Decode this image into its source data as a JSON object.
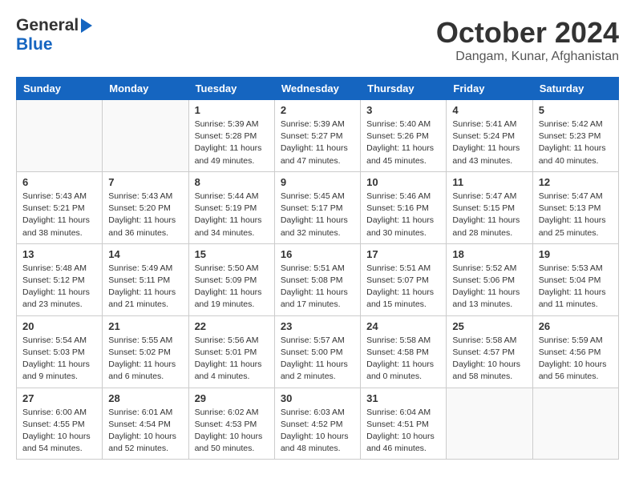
{
  "header": {
    "logo_general": "General",
    "logo_blue": "Blue",
    "month": "October 2024",
    "location": "Dangam, Kunar, Afghanistan"
  },
  "days_of_week": [
    "Sunday",
    "Monday",
    "Tuesday",
    "Wednesday",
    "Thursday",
    "Friday",
    "Saturday"
  ],
  "weeks": [
    [
      {
        "day": "",
        "info": ""
      },
      {
        "day": "",
        "info": ""
      },
      {
        "day": "1",
        "info": "Sunrise: 5:39 AM\nSunset: 5:28 PM\nDaylight: 11 hours and 49 minutes."
      },
      {
        "day": "2",
        "info": "Sunrise: 5:39 AM\nSunset: 5:27 PM\nDaylight: 11 hours and 47 minutes."
      },
      {
        "day": "3",
        "info": "Sunrise: 5:40 AM\nSunset: 5:26 PM\nDaylight: 11 hours and 45 minutes."
      },
      {
        "day": "4",
        "info": "Sunrise: 5:41 AM\nSunset: 5:24 PM\nDaylight: 11 hours and 43 minutes."
      },
      {
        "day": "5",
        "info": "Sunrise: 5:42 AM\nSunset: 5:23 PM\nDaylight: 11 hours and 40 minutes."
      }
    ],
    [
      {
        "day": "6",
        "info": "Sunrise: 5:43 AM\nSunset: 5:21 PM\nDaylight: 11 hours and 38 minutes."
      },
      {
        "day": "7",
        "info": "Sunrise: 5:43 AM\nSunset: 5:20 PM\nDaylight: 11 hours and 36 minutes."
      },
      {
        "day": "8",
        "info": "Sunrise: 5:44 AM\nSunset: 5:19 PM\nDaylight: 11 hours and 34 minutes."
      },
      {
        "day": "9",
        "info": "Sunrise: 5:45 AM\nSunset: 5:17 PM\nDaylight: 11 hours and 32 minutes."
      },
      {
        "day": "10",
        "info": "Sunrise: 5:46 AM\nSunset: 5:16 PM\nDaylight: 11 hours and 30 minutes."
      },
      {
        "day": "11",
        "info": "Sunrise: 5:47 AM\nSunset: 5:15 PM\nDaylight: 11 hours and 28 minutes."
      },
      {
        "day": "12",
        "info": "Sunrise: 5:47 AM\nSunset: 5:13 PM\nDaylight: 11 hours and 25 minutes."
      }
    ],
    [
      {
        "day": "13",
        "info": "Sunrise: 5:48 AM\nSunset: 5:12 PM\nDaylight: 11 hours and 23 minutes."
      },
      {
        "day": "14",
        "info": "Sunrise: 5:49 AM\nSunset: 5:11 PM\nDaylight: 11 hours and 21 minutes."
      },
      {
        "day": "15",
        "info": "Sunrise: 5:50 AM\nSunset: 5:09 PM\nDaylight: 11 hours and 19 minutes."
      },
      {
        "day": "16",
        "info": "Sunrise: 5:51 AM\nSunset: 5:08 PM\nDaylight: 11 hours and 17 minutes."
      },
      {
        "day": "17",
        "info": "Sunrise: 5:51 AM\nSunset: 5:07 PM\nDaylight: 11 hours and 15 minutes."
      },
      {
        "day": "18",
        "info": "Sunrise: 5:52 AM\nSunset: 5:06 PM\nDaylight: 11 hours and 13 minutes."
      },
      {
        "day": "19",
        "info": "Sunrise: 5:53 AM\nSunset: 5:04 PM\nDaylight: 11 hours and 11 minutes."
      }
    ],
    [
      {
        "day": "20",
        "info": "Sunrise: 5:54 AM\nSunset: 5:03 PM\nDaylight: 11 hours and 9 minutes."
      },
      {
        "day": "21",
        "info": "Sunrise: 5:55 AM\nSunset: 5:02 PM\nDaylight: 11 hours and 6 minutes."
      },
      {
        "day": "22",
        "info": "Sunrise: 5:56 AM\nSunset: 5:01 PM\nDaylight: 11 hours and 4 minutes."
      },
      {
        "day": "23",
        "info": "Sunrise: 5:57 AM\nSunset: 5:00 PM\nDaylight: 11 hours and 2 minutes."
      },
      {
        "day": "24",
        "info": "Sunrise: 5:58 AM\nSunset: 4:58 PM\nDaylight: 11 hours and 0 minutes."
      },
      {
        "day": "25",
        "info": "Sunrise: 5:58 AM\nSunset: 4:57 PM\nDaylight: 10 hours and 58 minutes."
      },
      {
        "day": "26",
        "info": "Sunrise: 5:59 AM\nSunset: 4:56 PM\nDaylight: 10 hours and 56 minutes."
      }
    ],
    [
      {
        "day": "27",
        "info": "Sunrise: 6:00 AM\nSunset: 4:55 PM\nDaylight: 10 hours and 54 minutes."
      },
      {
        "day": "28",
        "info": "Sunrise: 6:01 AM\nSunset: 4:54 PM\nDaylight: 10 hours and 52 minutes."
      },
      {
        "day": "29",
        "info": "Sunrise: 6:02 AM\nSunset: 4:53 PM\nDaylight: 10 hours and 50 minutes."
      },
      {
        "day": "30",
        "info": "Sunrise: 6:03 AM\nSunset: 4:52 PM\nDaylight: 10 hours and 48 minutes."
      },
      {
        "day": "31",
        "info": "Sunrise: 6:04 AM\nSunset: 4:51 PM\nDaylight: 10 hours and 46 minutes."
      },
      {
        "day": "",
        "info": ""
      },
      {
        "day": "",
        "info": ""
      }
    ]
  ]
}
